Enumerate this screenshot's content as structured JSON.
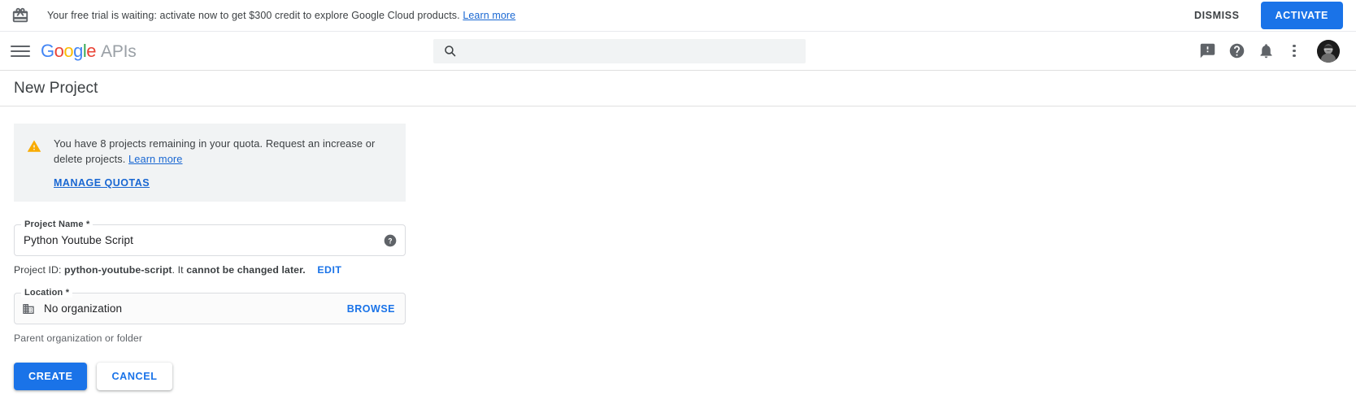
{
  "promo": {
    "icon": "gift-icon",
    "message": "Your free trial is waiting: activate now to get $300 credit to explore Google Cloud products.",
    "learn_more": "Learn more",
    "dismiss_label": "DISMISS",
    "activate_label": "ACTIVATE"
  },
  "appbar": {
    "menu_icon": "hamburger-menu-icon",
    "logo": {
      "g1": "G",
      "o1": "o",
      "o2": "o",
      "g2": "g",
      "l": "l",
      "e": "e",
      "product": "APIs"
    },
    "search": {
      "placeholder": "",
      "value": "",
      "icon": "search-icon"
    },
    "icons": [
      "feedback-icon",
      "help-icon",
      "notifications-icon",
      "more-options-icon"
    ],
    "avatar": "user-avatar"
  },
  "page": {
    "title": "New Project"
  },
  "quota_banner": {
    "icon": "warning-icon",
    "text_before": "You have 8 projects remaining in your quota. Request an increase or delete projects.",
    "learn_more": "Learn more",
    "manage_quotas_label": "MANAGE QUOTAS"
  },
  "project_name_field": {
    "label": "Project Name",
    "required_marker": "*",
    "value": "Python Youtube Script",
    "placeholder": "",
    "help_icon": "help-circle-icon"
  },
  "project_id": {
    "prefix": "Project ID:",
    "id": "python-youtube-script",
    "middle": ". It",
    "emphasis": "cannot be changed later.",
    "edit_label": "EDIT"
  },
  "location_field": {
    "label": "Location",
    "required_marker": "*",
    "icon": "organization-icon",
    "value": "No organization",
    "browse_label": "BROWSE",
    "helper_text": "Parent organization or folder"
  },
  "actions": {
    "create_label": "CREATE",
    "cancel_label": "CANCEL"
  },
  "colors": {
    "accent_blue": "#1a73e8",
    "link_blue": "#1967d2",
    "warning_amber": "#f9ab00",
    "surface_grey": "#f1f3f4"
  }
}
